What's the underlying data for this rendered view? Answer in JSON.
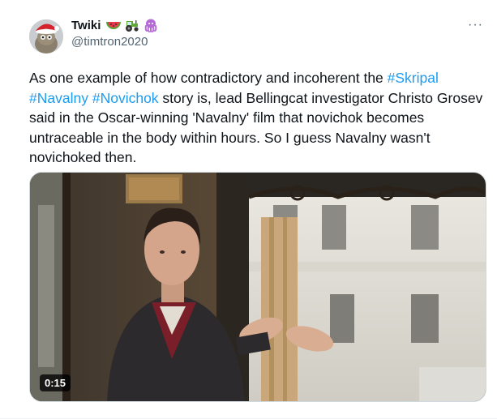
{
  "author": {
    "display_name": "Twiki",
    "emojis": [
      "watermelon-emoji",
      "tractor-emoji",
      "octopus-emoji"
    ],
    "handle": "@timtron2020"
  },
  "more_menu": "···",
  "tweet": {
    "text_parts": [
      {
        "type": "text",
        "value": "As one example of how contradictory and incoherent the "
      },
      {
        "type": "hashtag",
        "value": "#Skripal"
      },
      {
        "type": "text",
        "value": " "
      },
      {
        "type": "hashtag",
        "value": "#Navalny"
      },
      {
        "type": "text",
        "value": " "
      },
      {
        "type": "hashtag",
        "value": "#Novichok"
      },
      {
        "type": "text",
        "value": " story is, lead Bellingcat investigator Christo Grosev said in the Oscar-winning 'Navalny' film that novichok becomes untraceable in the body within hours. So I guess Navalny wasn't novichoked then."
      }
    ]
  },
  "media": {
    "video_timestamp": "0:15"
  },
  "colors": {
    "hashtag": "#1d9bf0",
    "text": "#0f1419",
    "secondary": "#536471"
  }
}
